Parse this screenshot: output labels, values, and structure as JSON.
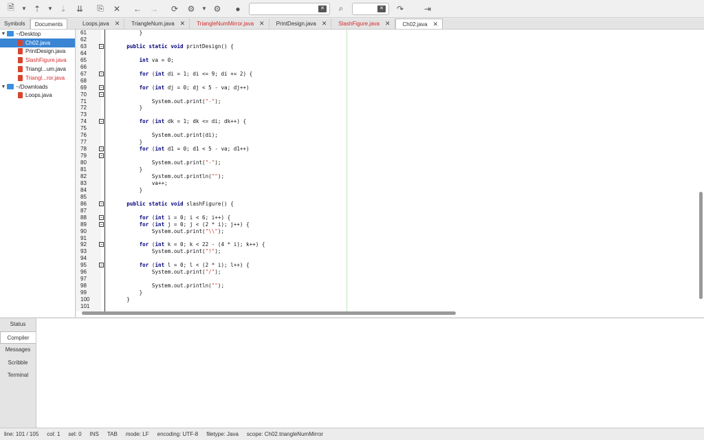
{
  "toolbar": {
    "buttons": [
      "new-file",
      "dropdown",
      "open-file",
      "dropdown",
      "save",
      "save-all",
      "revert",
      "close",
      "back",
      "forward",
      "reload",
      "build",
      "dropdown",
      "run",
      "color-picker"
    ],
    "search_value": "",
    "replace_value": ""
  },
  "side_tabs": [
    {
      "label": "Symbols",
      "active": false
    },
    {
      "label": "Documents",
      "active": true
    }
  ],
  "file_tabs": [
    {
      "label": "Loops.java",
      "modified": false,
      "active": false
    },
    {
      "label": "TriangleNum.java",
      "modified": false,
      "active": false
    },
    {
      "label": "TriangleNumMirror.java",
      "modified": true,
      "active": false
    },
    {
      "label": "PrintDesign.java",
      "modified": false,
      "active": false
    },
    {
      "label": "SlashFigure.java",
      "modified": true,
      "active": false
    },
    {
      "label": "Ch02.java",
      "modified": false,
      "active": true
    }
  ],
  "tree": [
    {
      "type": "folder",
      "label": "~/Desktop",
      "expanded": true
    },
    {
      "type": "file",
      "label": "Ch02.java",
      "selected": true,
      "modified": false
    },
    {
      "type": "file",
      "label": "PrintDesign.java",
      "selected": false,
      "modified": false
    },
    {
      "type": "file",
      "label": "SlashFigure.java",
      "selected": false,
      "modified": true
    },
    {
      "type": "file",
      "label": "Triangl...um.java",
      "selected": false,
      "modified": false
    },
    {
      "type": "file",
      "label": "Triangl...ror.java",
      "selected": false,
      "modified": true
    },
    {
      "type": "folder",
      "label": "~/Downloads",
      "expanded": true
    },
    {
      "type": "file",
      "label": "Loops.java",
      "selected": false,
      "modified": false
    }
  ],
  "code_lines": [
    {
      "n": "61",
      "t": "        }"
    },
    {
      "n": "62",
      "t": ""
    },
    {
      "n": "63",
      "t": "    public static void printDesign() {",
      "fold": true
    },
    {
      "n": "64",
      "t": ""
    },
    {
      "n": "65",
      "t": "        int va = 0;"
    },
    {
      "n": "66",
      "t": ""
    },
    {
      "n": "67",
      "t": "        for (int di = 1; di <= 9; di += 2) {",
      "fold": true
    },
    {
      "n": "68",
      "t": ""
    },
    {
      "n": "69",
      "t": "        for (int dj = 0; dj < 5 - va; dj++)",
      "fold": true
    },
    {
      "n": "70",
      "t": "",
      "fold": true
    },
    {
      "n": "71",
      "t": "            System.out.print(\"-\");"
    },
    {
      "n": "72",
      "t": "        }"
    },
    {
      "n": "73",
      "t": ""
    },
    {
      "n": "74",
      "t": "        for (int dk = 1; dk <= di; dk++) {",
      "fold": true
    },
    {
      "n": "75",
      "t": ""
    },
    {
      "n": "76",
      "t": "            System.out.print(di);"
    },
    {
      "n": "77",
      "t": "        }"
    },
    {
      "n": "78",
      "t": "        for (int d1 = 0; d1 < 5 - va; d1++)",
      "fold": true
    },
    {
      "n": "79",
      "t": "",
      "fold": true
    },
    {
      "n": "80",
      "t": "            System.out.print(\"-\");"
    },
    {
      "n": "81",
      "t": "        }"
    },
    {
      "n": "82",
      "t": "            System.out.println(\"\");"
    },
    {
      "n": "83",
      "t": "            va++;"
    },
    {
      "n": "84",
      "t": "        }"
    },
    {
      "n": "85",
      "t": ""
    },
    {
      "n": "86",
      "t": "    public static void slashFigure() {",
      "fold": true
    },
    {
      "n": "87",
      "t": ""
    },
    {
      "n": "88",
      "t": "        for (int i = 0; i < 6; i++) {",
      "fold": true
    },
    {
      "n": "89",
      "t": "        for (int j = 0; j < (2 * i); j++) {",
      "fold": true
    },
    {
      "n": "90",
      "t": "            System.out.print(\"\\\\\");"
    },
    {
      "n": "91",
      "t": ""
    },
    {
      "n": "92",
      "t": "        for (int k = 0; k < 22 - (4 * i); k++) {",
      "fold": true
    },
    {
      "n": "93",
      "t": "            System.out.print(\"!\");"
    },
    {
      "n": "94",
      "t": ""
    },
    {
      "n": "95",
      "t": "        for (int l = 0; l < (2 * i); l++) {",
      "fold": true
    },
    {
      "n": "96",
      "t": "            System.out.print(\"/\");"
    },
    {
      "n": "97",
      "t": ""
    },
    {
      "n": "98",
      "t": "            System.out.println(\"\");"
    },
    {
      "n": "99",
      "t": "        }"
    },
    {
      "n": "100",
      "t": "    }"
    },
    {
      "n": "101",
      "t": ""
    }
  ],
  "bottom_tabs": [
    {
      "label": "Status",
      "active": false
    },
    {
      "label": "Compiler",
      "active": true
    },
    {
      "label": "Messages",
      "active": false
    },
    {
      "label": "Scribble",
      "active": false
    },
    {
      "label": "Terminal",
      "active": false
    }
  ],
  "status": {
    "line": "line: 101 / 105",
    "col": "col: 1",
    "sel": "sel: 0",
    "ins": "INS",
    "tab": "TAB",
    "mode": "mode: LF",
    "encoding": "encoding: UTF-8",
    "filetype": "filetype: Java",
    "scope": "scope: Ch02.triangleNumMirror"
  },
  "colors": {
    "selection": "#3a84d4",
    "modified_tab": "#d42a2a",
    "keyword": "#00007a",
    "string": "#d4382a"
  }
}
